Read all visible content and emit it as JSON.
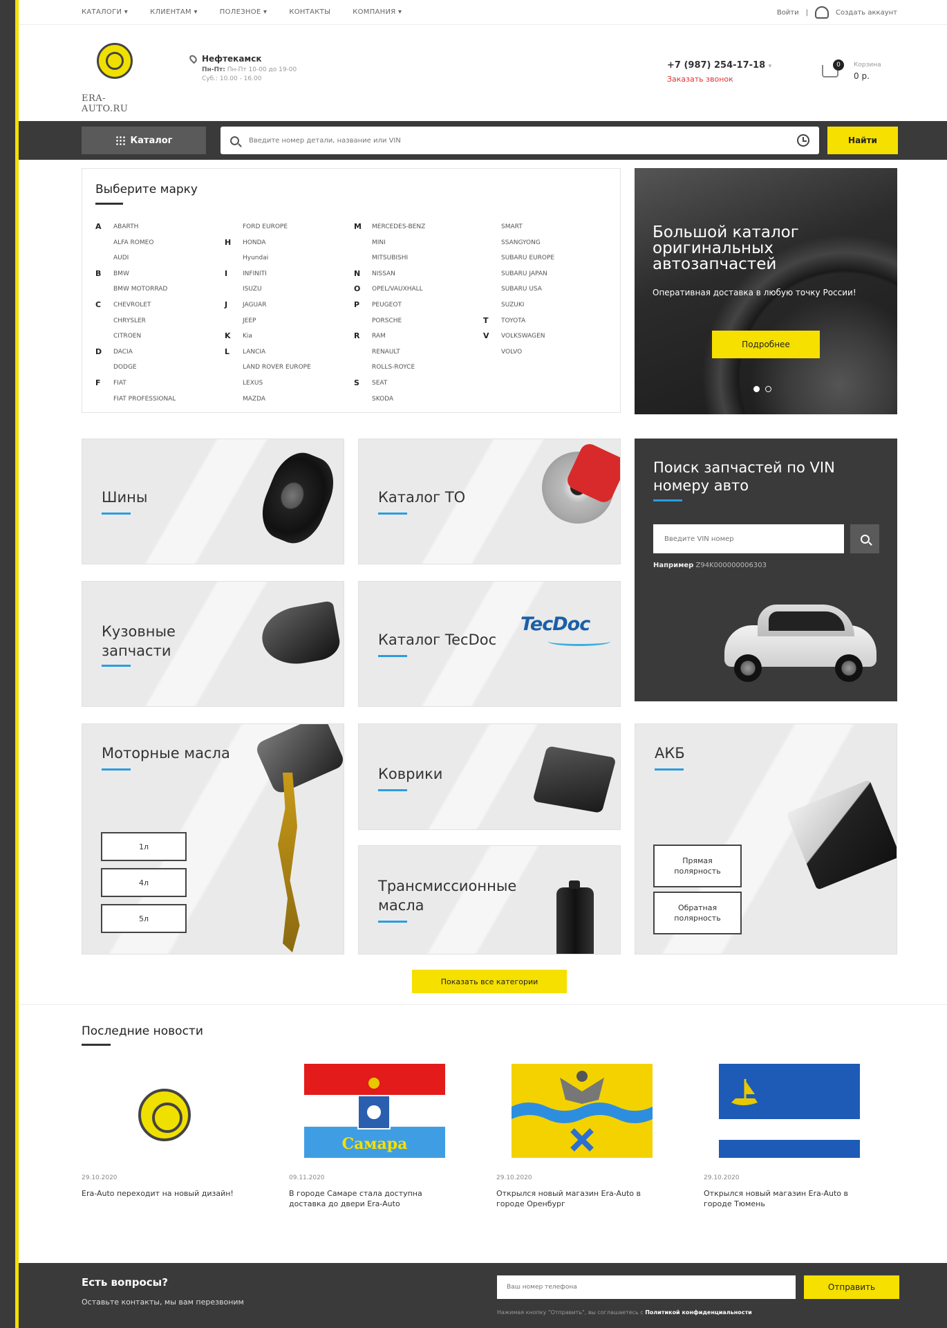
{
  "topbar": {
    "nav": [
      "КАТАЛОГИ ▾",
      "КЛИЕНТАМ ▾",
      "ПОЛЕЗНОЕ ▾",
      "КОНТАКТЫ",
      "КОМПАНИЯ ▾"
    ],
    "login": "Войти",
    "separator": "|",
    "create_account": "Создать аккаунт"
  },
  "header": {
    "logo_text": "ERA-AUTO.RU",
    "city": "Нефтекамск",
    "hours_1_label": "Пн-Пт:",
    "hours_1": "Пн-Пт 10-00 до 19-00",
    "hours_2": "Суб.: 10.00 - 16.00",
    "phone": "+7 (987) 254-17-18",
    "phone_caret": "▾",
    "callback": "Заказать звонок",
    "cart_count": "0",
    "cart_label": "Корзина",
    "cart_sum": "0 р."
  },
  "searchbar": {
    "catalog_label": "Каталог",
    "placeholder": "Введите номер детали, название или VIN",
    "find_label": "Найти"
  },
  "brands": {
    "title": "Выберите марку",
    "columns": [
      [
        {
          "letter": "A",
          "name": "ABARTH"
        },
        {
          "letter": "",
          "name": "ALFA ROMEO"
        },
        {
          "letter": "",
          "name": "AUDI"
        },
        {
          "letter": "B",
          "name": "BMW"
        },
        {
          "letter": "",
          "name": "BMW MOTORRAD"
        },
        {
          "letter": "C",
          "name": "CHEVROLET"
        },
        {
          "letter": "",
          "name": "CHRYSLER"
        },
        {
          "letter": "",
          "name": "CITROEN"
        },
        {
          "letter": "D",
          "name": "DACIA"
        },
        {
          "letter": "",
          "name": "DODGE"
        },
        {
          "letter": "F",
          "name": "FIAT"
        },
        {
          "letter": "",
          "name": "FIAT PROFESSIONAL"
        }
      ],
      [
        {
          "letter": "",
          "name": "FORD EUROPE"
        },
        {
          "letter": "H",
          "name": "HONDA"
        },
        {
          "letter": "",
          "name": "Hyundai"
        },
        {
          "letter": "I",
          "name": "INFINITI"
        },
        {
          "letter": "",
          "name": "ISUZU"
        },
        {
          "letter": "J",
          "name": "JAGUAR"
        },
        {
          "letter": "",
          "name": "JEEP"
        },
        {
          "letter": "K",
          "name": "Kia"
        },
        {
          "letter": "L",
          "name": "LANCIA"
        },
        {
          "letter": "",
          "name": "LAND ROVER EUROPE"
        },
        {
          "letter": "",
          "name": "LEXUS"
        },
        {
          "letter": "",
          "name": "MAZDA"
        }
      ],
      [
        {
          "letter": "M",
          "name": "MERCEDES-BENZ"
        },
        {
          "letter": "",
          "name": "MINI"
        },
        {
          "letter": "",
          "name": "MITSUBISHI"
        },
        {
          "letter": "N",
          "name": "NISSAN"
        },
        {
          "letter": "O",
          "name": "OPEL/VAUXHALL"
        },
        {
          "letter": "P",
          "name": "PEUGEOT"
        },
        {
          "letter": "",
          "name": "PORSCHE"
        },
        {
          "letter": "R",
          "name": "RAM"
        },
        {
          "letter": "",
          "name": "RENAULT"
        },
        {
          "letter": "",
          "name": "ROLLS-ROYCE"
        },
        {
          "letter": "S",
          "name": "SEAT"
        },
        {
          "letter": "",
          "name": "SKODA"
        }
      ],
      [
        {
          "letter": "",
          "name": "SMART"
        },
        {
          "letter": "",
          "name": "SSANGYONG"
        },
        {
          "letter": "",
          "name": "SUBARU EUROPE"
        },
        {
          "letter": "",
          "name": "SUBARU JAPAN"
        },
        {
          "letter": "",
          "name": "SUBARU USA"
        },
        {
          "letter": "",
          "name": "SUZUKI"
        },
        {
          "letter": "T",
          "name": "TOYOTA"
        },
        {
          "letter": "V",
          "name": "VOLKSWAGEN"
        },
        {
          "letter": "",
          "name": "VOLVO"
        }
      ]
    ]
  },
  "hero": {
    "title": "Большой каталог оригинальных автозапчастей",
    "text": "Оперативная доставка в любую точку России!",
    "button": "Подробнее"
  },
  "categories": {
    "tires": "Шины",
    "to": "Каталог ТО",
    "body": "Кузовные запчасти",
    "tecdoc": "Каталог TecDoc",
    "tecdoc_logo": "TecDoc",
    "oils": "Моторные масла",
    "oil_volumes": [
      "1л",
      "4л",
      "5л"
    ],
    "mats": "Коврики",
    "trans": "Трансмиссионные масла",
    "akb": "АКБ",
    "polarity": [
      "Прямая полярность",
      "Обратная полярность"
    ]
  },
  "vin": {
    "title": "Поиск запчастей по VIN номеру авто",
    "placeholder": "Введите VIN номер",
    "example_label": "Например",
    "example": "Z94K000000006303"
  },
  "show_all": "Показать все категории",
  "news": {
    "title": "Последние новости",
    "items": [
      {
        "date": "29.10.2020",
        "text": "Era-Auto переходит на новый дизайн!"
      },
      {
        "date": "09.11.2020",
        "text": "В городе Самаре стала доступна доставка до двери Era-Auto"
      },
      {
        "date": "29.10.2020",
        "text": "Открылся новый магазин Era-Auto в городе Оренбург"
      },
      {
        "date": "29.10.2020",
        "text": "Открылся новый магазин Era-Auto в городе Тюмень"
      }
    ],
    "samara_flag_text": "Самара"
  },
  "footer": {
    "question": "Есть вопросы?",
    "subtitle": "Оставьте контакты, мы вам перезвоним",
    "phone_placeholder": "Ваш номер телефона",
    "send": "Отправить",
    "note": "Нажимая кнопку \"Отправить\", вы соглашаетесь с",
    "policy": "Политикой конфиденциальности"
  },
  "colors": {
    "accent": "#f5e000",
    "dark": "#3a3a3a",
    "link_blue": "#2a9de0",
    "callback_red": "#e03030"
  }
}
